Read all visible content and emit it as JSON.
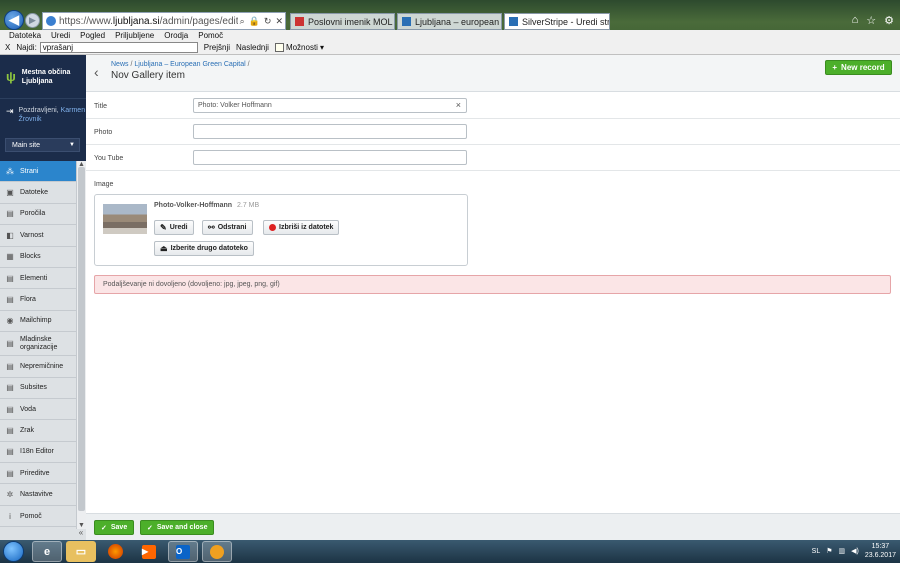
{
  "browser": {
    "url_prefix": "https://www.",
    "url_domain": "ljubljana.si",
    "url_path": "/admin/pages/edit/EditForm/field/News/item",
    "tabs": [
      {
        "label": "Poslovni imenik MOL - Vsi stiki",
        "active": false
      },
      {
        "label": "Ljubljana – european green ca...",
        "active": false
      },
      {
        "label": "SilverStripe - Uredi stran",
        "active": true
      }
    ],
    "menu": [
      "Datoteka",
      "Uredi",
      "Pogled",
      "Priljubljene",
      "Orodja",
      "Pomoč"
    ],
    "find": {
      "close": "X",
      "label": "Najdi:",
      "value": "vprašanj",
      "prev": "Prejšnji",
      "next": "Naslednji",
      "options": "Možnosti"
    }
  },
  "sidebar": {
    "brand": "Mestna občina Ljubljana",
    "greeting": "Pozdravljeni,",
    "user_name": "Karmen Žrovnik",
    "site_select": "Main site",
    "items": [
      {
        "label": "Strani",
        "icon": "sitemap-icon",
        "glyph": "⁂",
        "active": true
      },
      {
        "label": "Datoteke",
        "icon": "image-icon",
        "glyph": "▣",
        "active": false
      },
      {
        "label": "Poročila",
        "icon": "reports-icon",
        "glyph": "▤",
        "active": false
      },
      {
        "label": "Varnost",
        "icon": "security-icon",
        "glyph": "◧",
        "active": false
      },
      {
        "label": "Blocks",
        "icon": "blocks-icon",
        "glyph": "▦",
        "active": false
      },
      {
        "label": "Elementi",
        "icon": "elements-icon",
        "glyph": "▤",
        "active": false
      },
      {
        "label": "Flora",
        "icon": "flora-icon",
        "glyph": "▤",
        "active": false
      },
      {
        "label": "Mailchimp",
        "icon": "mailchimp-icon",
        "glyph": "◉",
        "active": false
      },
      {
        "label": "Mladinske organizacije",
        "icon": "youth-icon",
        "glyph": "▤",
        "active": false,
        "tall": true
      },
      {
        "label": "Nepremičnine",
        "icon": "realestate-icon",
        "glyph": "▤",
        "active": false
      },
      {
        "label": "Subsites",
        "icon": "subsites-icon",
        "glyph": "▤",
        "active": false
      },
      {
        "label": "Voda",
        "icon": "water-icon",
        "glyph": "▤",
        "active": false
      },
      {
        "label": "Zrak",
        "icon": "air-icon",
        "glyph": "▤",
        "active": false
      },
      {
        "label": "I18n Editor",
        "icon": "i18n-icon",
        "glyph": "▤",
        "active": false
      },
      {
        "label": "Prireditve",
        "icon": "events-icon",
        "glyph": "▤",
        "active": false
      },
      {
        "label": "Nastavitve",
        "icon": "settings-icon",
        "glyph": "✲",
        "active": false
      },
      {
        "label": "Pomoč",
        "icon": "help-icon",
        "glyph": "i",
        "active": false
      }
    ]
  },
  "header": {
    "breadcrumbs": [
      "News",
      "Ljubljana – European Green Capital"
    ],
    "title": "Nov Gallery item",
    "new_record": "New record"
  },
  "form": {
    "title_label": "Title",
    "title_value": "Photo: Volker Hoffmann",
    "photo_label": "Photo",
    "youtube_label": "You Tube",
    "image_label": "Image",
    "file_name": "Photo-Volker-Hoffmann",
    "file_size": "2.7 MB",
    "edit_btn": "Uredi",
    "remove_btn": "Odstrani",
    "delete_btn": "Izbriši iz datotek",
    "choose_btn": "Izberite drugo datoteko",
    "error": "Podaljševanje ni dovoljeno (dovoljeno: jpg, jpeg, png, gif)"
  },
  "footer": {
    "save": "Save",
    "save_close": "Save and close"
  },
  "taskbar": {
    "lang": "SL",
    "time": "15:37",
    "date": "23.6.2017"
  },
  "colors": {
    "sidebar_dark": "#1b2c4a",
    "active_nav": "#2b85cc",
    "green_button": "#4caf2a",
    "alert_bg": "#fbe5e6"
  }
}
